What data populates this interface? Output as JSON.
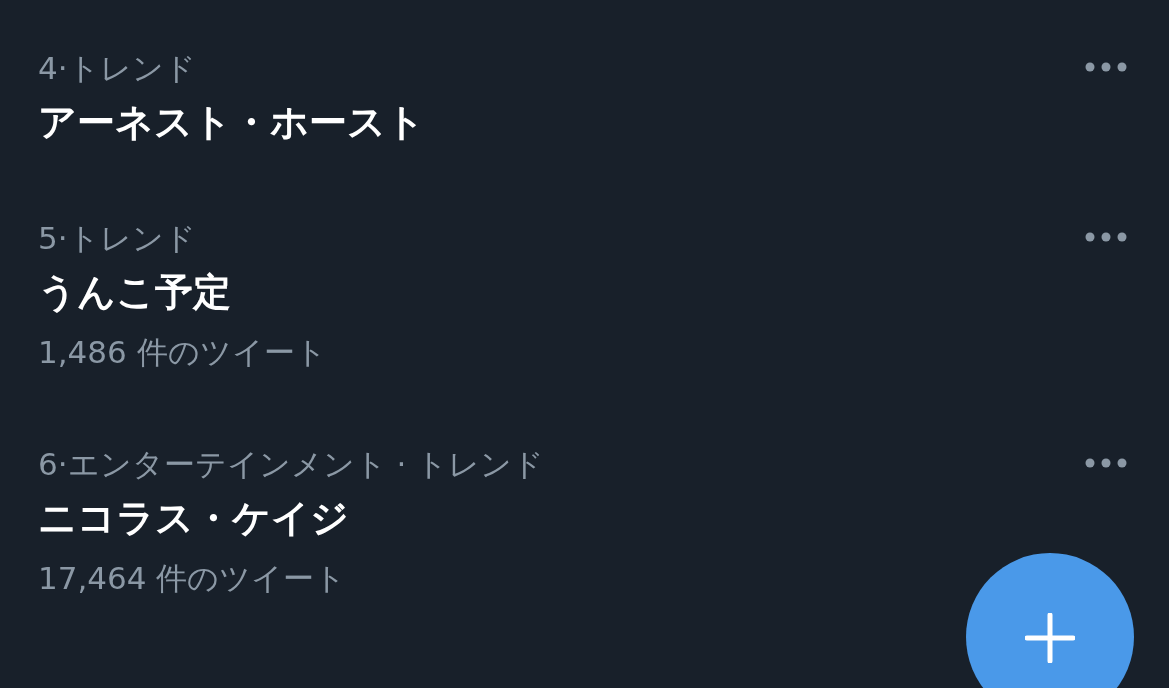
{
  "trends": [
    {
      "category": "4·トレンド",
      "title": "アーネスト・ホースト"
    },
    {
      "category": "5·トレンド",
      "title": "うんこ予定",
      "tweet_count": "1,486 件のツイート"
    },
    {
      "category": "6·エンターテインメント · トレンド",
      "title": "ニコラス・ケイジ",
      "tweet_count": "17,464 件のツイート"
    }
  ]
}
